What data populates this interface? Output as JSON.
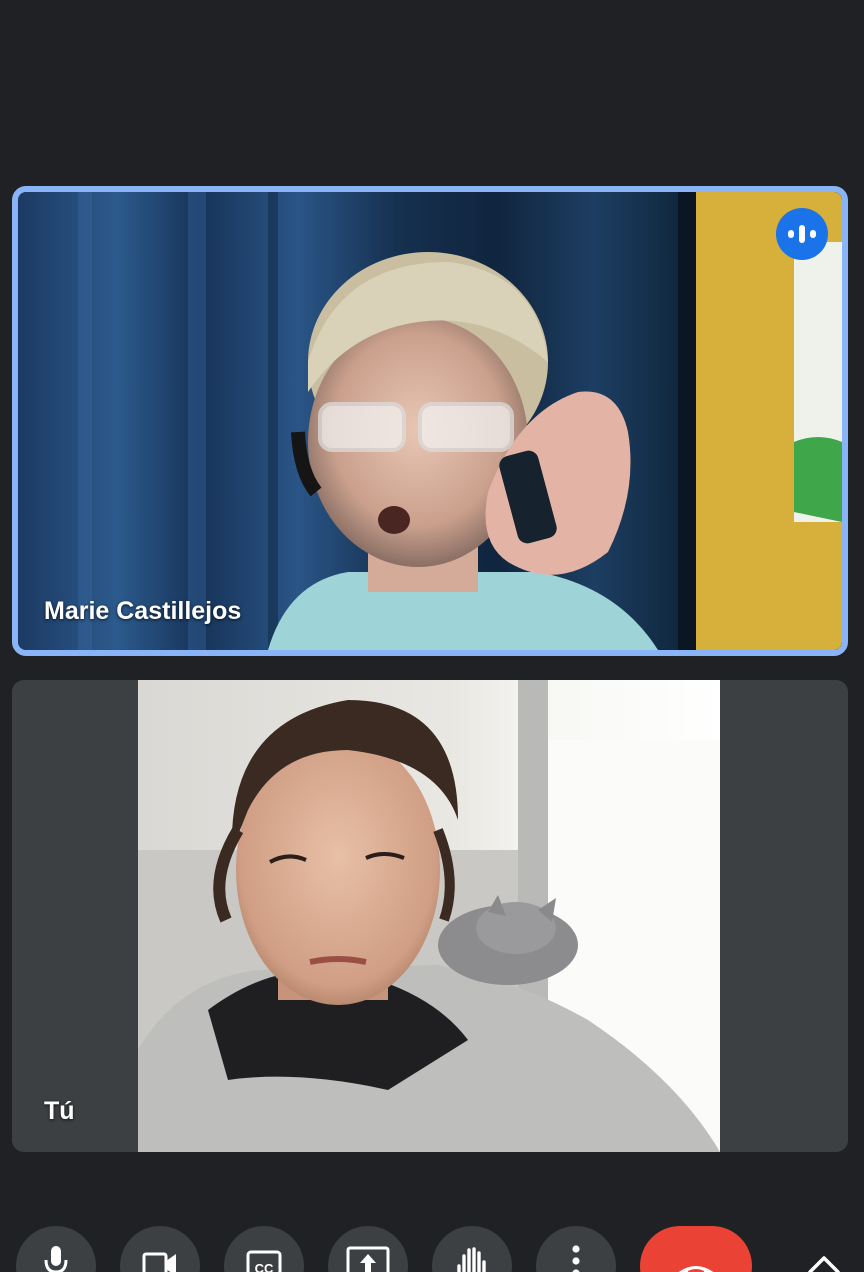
{
  "participants": [
    {
      "name": "Marie Castillejos",
      "speaking": true
    },
    {
      "name": "Tú",
      "speaking": false
    }
  ],
  "colors": {
    "background": "#202124",
    "tile": "#3c4043",
    "active_border": "#8ab4f8",
    "speaking_badge": "#1a73e8",
    "end_call": "#ea4335"
  },
  "controls": [
    {
      "id": "mic",
      "icon": "microphone-icon"
    },
    {
      "id": "camera",
      "icon": "video-camera-icon"
    },
    {
      "id": "captions",
      "icon": "closed-captions-icon",
      "label": "CC"
    },
    {
      "id": "present",
      "icon": "present-screen-icon"
    },
    {
      "id": "raise-hand",
      "icon": "raise-hand-icon"
    },
    {
      "id": "more",
      "icon": "more-vert-icon"
    },
    {
      "id": "end-call",
      "icon": "end-call-icon"
    },
    {
      "id": "expand",
      "icon": "chevron-up-icon"
    }
  ]
}
